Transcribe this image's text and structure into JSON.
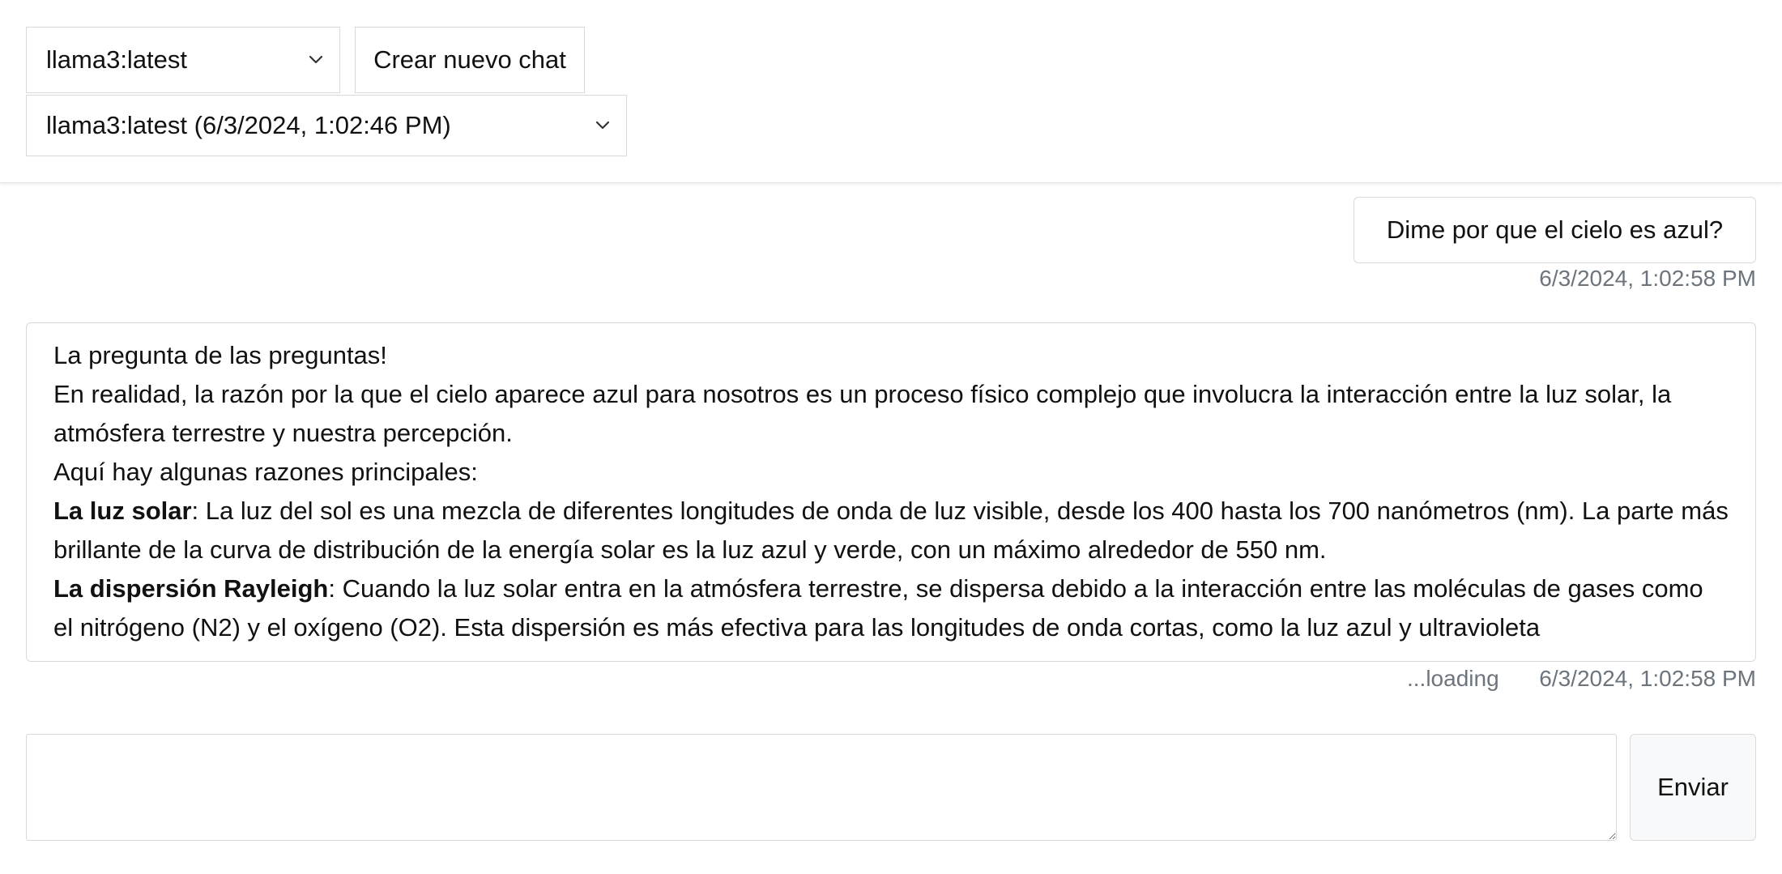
{
  "header": {
    "model_select_value": "llama3:latest",
    "new_chat_label": "Crear nuevo chat",
    "chat_select_value": "llama3:latest (6/3/2024, 1:02:46 PM)"
  },
  "messages": {
    "user": {
      "text": "Dime por que el cielo es azul?",
      "timestamp": "6/3/2024, 1:02:58 PM"
    },
    "assistant": {
      "line1": "La pregunta de las preguntas!",
      "line2": "En realidad, la razón por la que el cielo aparece azul para nosotros es un proceso físico complejo que involucra la interacción entre la luz solar, la atmósfera terrestre y nuestra percepción.",
      "line3": "Aquí hay algunas razones principales:",
      "point1_title": "La luz solar",
      "point1_text": ": La luz del sol es una mezcla de diferentes longitudes de onda de luz visible, desde los 400 hasta los 700 nanómetros (nm). La parte más brillante de la curva de distribución de la energía solar es la luz azul y verde, con un máximo alrededor de 550 nm.",
      "point2_title": "La dispersión Rayleigh",
      "point2_text": ": Cuando la luz solar entra en la atmósfera terrestre, se dispersa debido a la interacción entre las moléculas de gases como el nitrógeno (N2) y el oxígeno (O2). Esta dispersión es más efectiva para las longitudes de onda cortas, como la luz azul y ultravioleta",
      "loading_text": "...loading",
      "timestamp": "6/3/2024, 1:02:58 PM"
    }
  },
  "composer": {
    "input_value": "",
    "send_label": "Enviar"
  },
  "icons": {
    "select_chevron": "chevron-down-icon",
    "resize_handle": "resize-handle-icon"
  },
  "colors": {
    "border": "#d9d9d9",
    "muted_text": "#6c757d",
    "send_button_bg": "#f8f9fa"
  }
}
